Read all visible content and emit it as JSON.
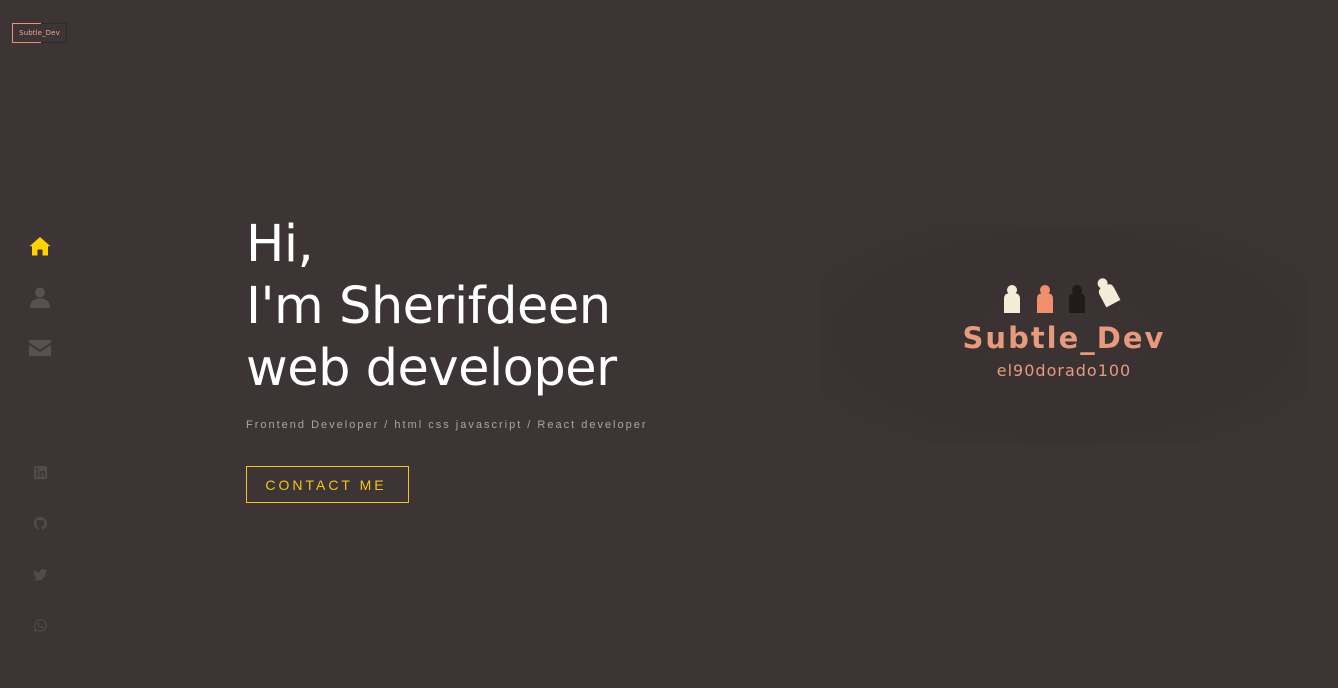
{
  "logo": {
    "text": "Subtle_Dev"
  },
  "nav": {
    "items": [
      {
        "icon": "home-icon",
        "active": true
      },
      {
        "icon": "user-icon",
        "active": false
      },
      {
        "icon": "envelope-icon",
        "active": false
      }
    ]
  },
  "social": {
    "items": [
      {
        "icon": "linkedin-icon"
      },
      {
        "icon": "github-icon"
      },
      {
        "icon": "twitter-icon"
      },
      {
        "icon": "whatsapp-icon"
      }
    ]
  },
  "hero": {
    "line1": "Hi,",
    "line2": "I'm Sherifdeen",
    "line3": "web developer",
    "tagline": "Frontend Developer / html css javascript / React developer",
    "contact_label": "CONTACT ME"
  },
  "brand": {
    "name": "Subtle_Dev",
    "handle": "el90dorado100"
  },
  "colors": {
    "background": "#3d3535",
    "accent": "#f2c519",
    "brand": "#e79a7d",
    "icon_muted": "#555050"
  }
}
